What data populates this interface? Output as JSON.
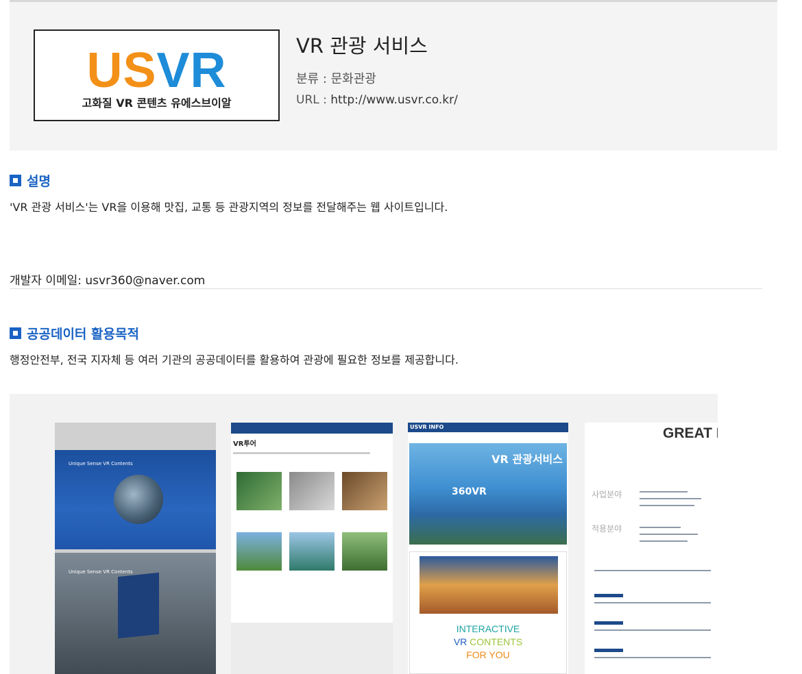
{
  "service": {
    "logo_us": "US",
    "logo_vr": "VR",
    "logo_subtitle": "고화질 VR 콘텐츠 유에스브이알",
    "title": "VR 관광 서비스",
    "category_label": "분류 : 문화관광",
    "url_label": "URL : ",
    "url": "http://www.usvr.co.kr/"
  },
  "description": {
    "heading": "설명",
    "text": "'VR 관광 서비스'는 VR을 이용해 맛집, 교통 등 관광지역의 정보를 전달해주는 웹 사이트입니다.",
    "developer_email": "개발자 이메일: usvr360@naver.com"
  },
  "purpose": {
    "heading": "공공데이터 활용목적",
    "text": "행정안전부, 전국 지자체 등 여러 기관의 공공데이터를 활용하여 관광에 필요한 정보를 제공합니다."
  },
  "gallery": {
    "thumb1": {
      "text_a": "Unique Sense VR Contents",
      "text_b": "Unique Sense VR Contents"
    },
    "thumb2": {
      "title": "VR투어"
    },
    "thumb3": {
      "header": "USVR INFO",
      "hero_title": "VR 관광서비스",
      "hero_360": "360VR",
      "line1": "INTERACTIVE",
      "line2a": "VR ",
      "line2b": "CONTENTS",
      "line3": "FOR YOU"
    },
    "thumb4": {
      "headline": "GREAT IDEA",
      "label1": "사업분야",
      "label2": "적용분야"
    }
  },
  "colors": {
    "accent_blue": "#1a63c4",
    "logo_orange": "#f39017",
    "logo_blue": "#1e8cd8"
  }
}
